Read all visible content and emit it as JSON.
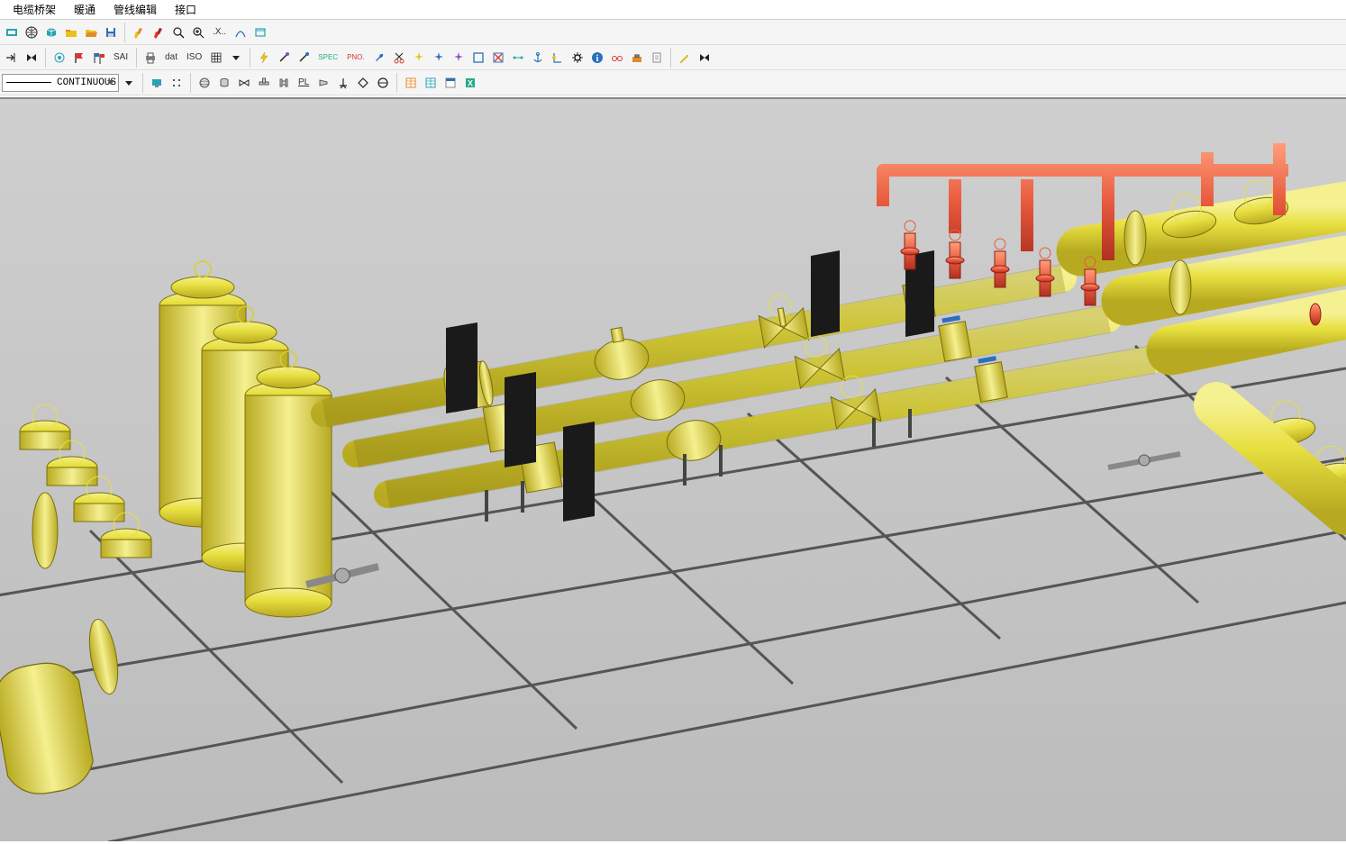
{
  "menu": {
    "items": [
      {
        "label": "电缆桥架"
      },
      {
        "label": "暖通"
      },
      {
        "label": "管线编辑"
      },
      {
        "label": "接口"
      }
    ]
  },
  "toolbars": {
    "row1": {
      "labels": {
        "sai": "SAI",
        "dat": "dat",
        "iso": "ISO",
        "x": ".X.."
      }
    },
    "row2": {
      "linetype": {
        "value": "CONTINUOUS"
      },
      "labels": {
        "pl": "PL",
        "spec": "SPEC",
        "pno": "PNO."
      }
    }
  },
  "viewport": {
    "description": "3D CAD isometric view of industrial piping system"
  }
}
